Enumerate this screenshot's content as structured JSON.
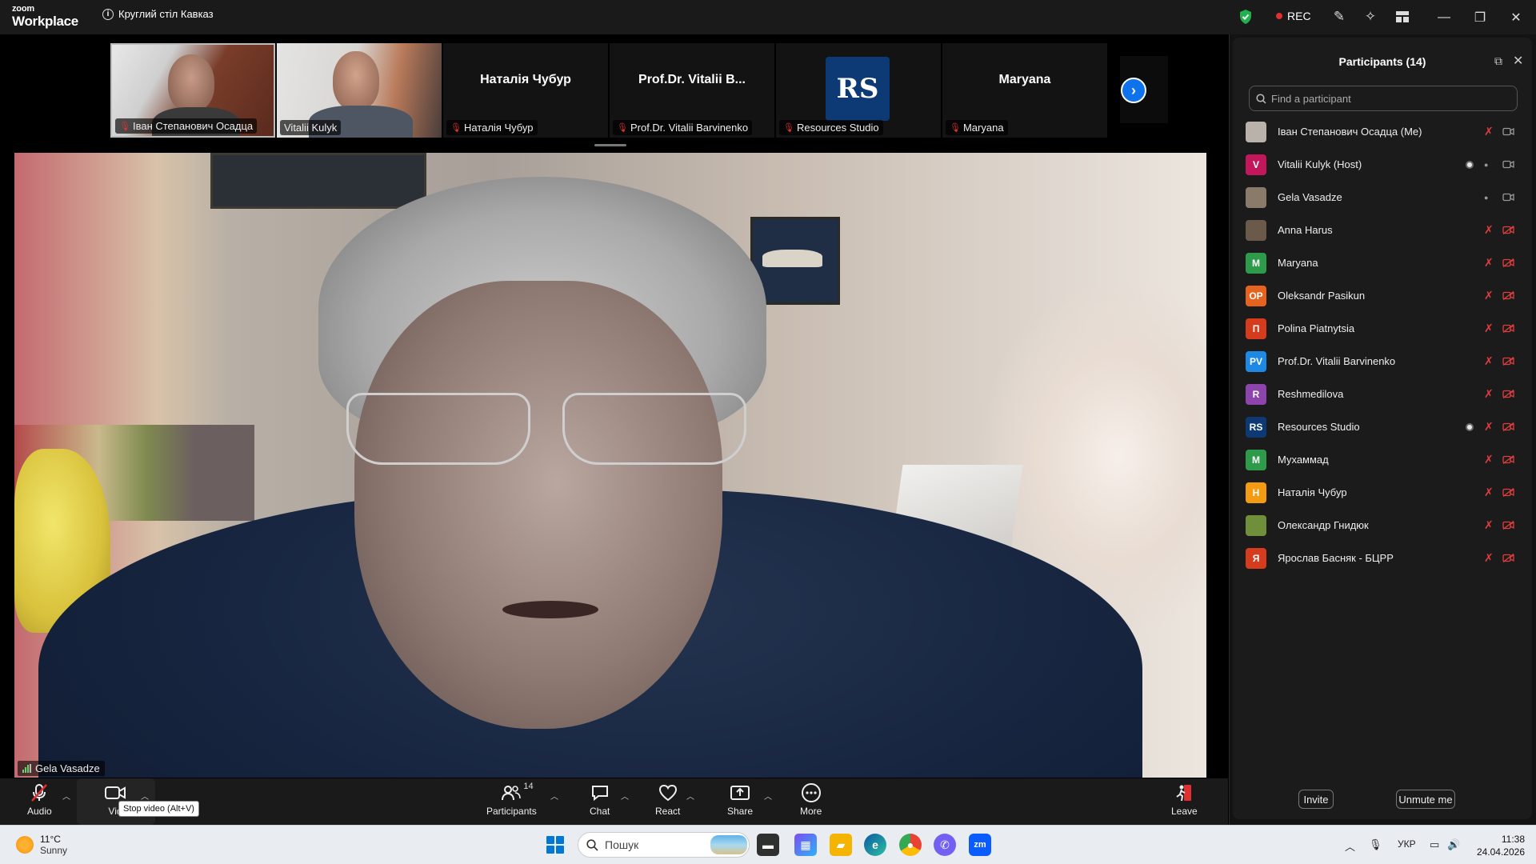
{
  "app": {
    "logo_line1": "zoom",
    "logo_line2": "Workplace",
    "meeting_title": "Круглий стіл Кавказ",
    "rec_label": "REC"
  },
  "gallery": {
    "tiles": [
      {
        "label": "Іван Степанович Осадца",
        "type": "video"
      },
      {
        "label": "Vitalii Kulyk",
        "type": "video"
      },
      {
        "display_name": "Наталія Чубур",
        "label": "Наталія Чубур",
        "type": "name"
      },
      {
        "display_name": "Prof.Dr. Vitalii B...",
        "label": "Prof.Dr. Vitalii Barvinenko",
        "type": "name"
      },
      {
        "logo_text": "RS",
        "label": "Resources Studio",
        "type": "logo"
      },
      {
        "display_name": "Maryana",
        "label": "Maryana",
        "type": "name"
      }
    ]
  },
  "main_video": {
    "speaker": "Gela Vasadze"
  },
  "toolbar": {
    "audio": "Audio",
    "video": "Vid",
    "video_tooltip": "Stop video (Alt+V)",
    "participants": "Participants",
    "participants_count": "14",
    "chat": "Chat",
    "react": "React",
    "share": "Share",
    "more": "More",
    "leave": "Leave"
  },
  "panel": {
    "title": "Participants (14)",
    "search_placeholder": "Find a participant",
    "invite": "Invite",
    "unmute_me": "Unmute me",
    "participants": [
      {
        "name": "Іван Степанович Осадца (Me)",
        "avatar": "",
        "avatar_color": "#b9b2aa",
        "mic": "muted",
        "cam": "on",
        "dot": false
      },
      {
        "name": "Vitalii Kulyk (Host)",
        "avatar": "V",
        "avatar_color": "#c2185b",
        "mic": "on",
        "cam": "on",
        "dot": true
      },
      {
        "name": "Gela Vasadze",
        "avatar": "",
        "avatar_color": "#8a7a6a",
        "mic": "on",
        "cam": "on",
        "dot": false
      },
      {
        "name": "Anna Harus",
        "avatar": "",
        "avatar_color": "#6b5a4a",
        "mic": "muted",
        "cam": "off",
        "dot": false
      },
      {
        "name": "Maryana",
        "avatar": "M",
        "avatar_color": "#2e9b4b",
        "mic": "muted",
        "cam": "off",
        "dot": false
      },
      {
        "name": "Oleksandr Pasikun",
        "avatar": "OP",
        "avatar_color": "#e5621f",
        "mic": "muted",
        "cam": "off",
        "dot": false
      },
      {
        "name": "Polina Piatnytsia",
        "avatar": "П",
        "avatar_color": "#d43c1d",
        "mic": "muted",
        "cam": "off",
        "dot": false
      },
      {
        "name": "Prof.Dr. Vitalii Barvinenko",
        "avatar": "PV",
        "avatar_color": "#1e88e5",
        "mic": "muted",
        "cam": "off",
        "dot": false
      },
      {
        "name": "Reshmedilova",
        "avatar": "R",
        "avatar_color": "#8e44ad",
        "mic": "muted",
        "cam": "off",
        "dot": false
      },
      {
        "name": "Resources Studio",
        "avatar": "RS",
        "avatar_color": "#0d3a75",
        "mic": "muted",
        "cam": "off",
        "dot": true
      },
      {
        "name": "Мухаммад",
        "avatar": "M",
        "avatar_color": "#2e9b4b",
        "mic": "muted",
        "cam": "off",
        "dot": false
      },
      {
        "name": "Наталія Чубур",
        "avatar": "Н",
        "avatar_color": "#f39c12",
        "mic": "muted",
        "cam": "off",
        "dot": false
      },
      {
        "name": "Олександр Гнидюк",
        "avatar": "",
        "avatar_color": "#6f8f3a",
        "mic": "muted",
        "cam": "off",
        "dot": false
      },
      {
        "name": "Ярослав Басняк - БЦРР",
        "avatar": "Я",
        "avatar_color": "#d43c1d",
        "mic": "muted",
        "cam": "off",
        "dot": false
      }
    ]
  },
  "taskbar": {
    "temp": "11°C",
    "condition": "Sunny",
    "search_placeholder": "Пошук",
    "lang": "УКР",
    "time": "11:38",
    "date": "24.04.2026"
  }
}
